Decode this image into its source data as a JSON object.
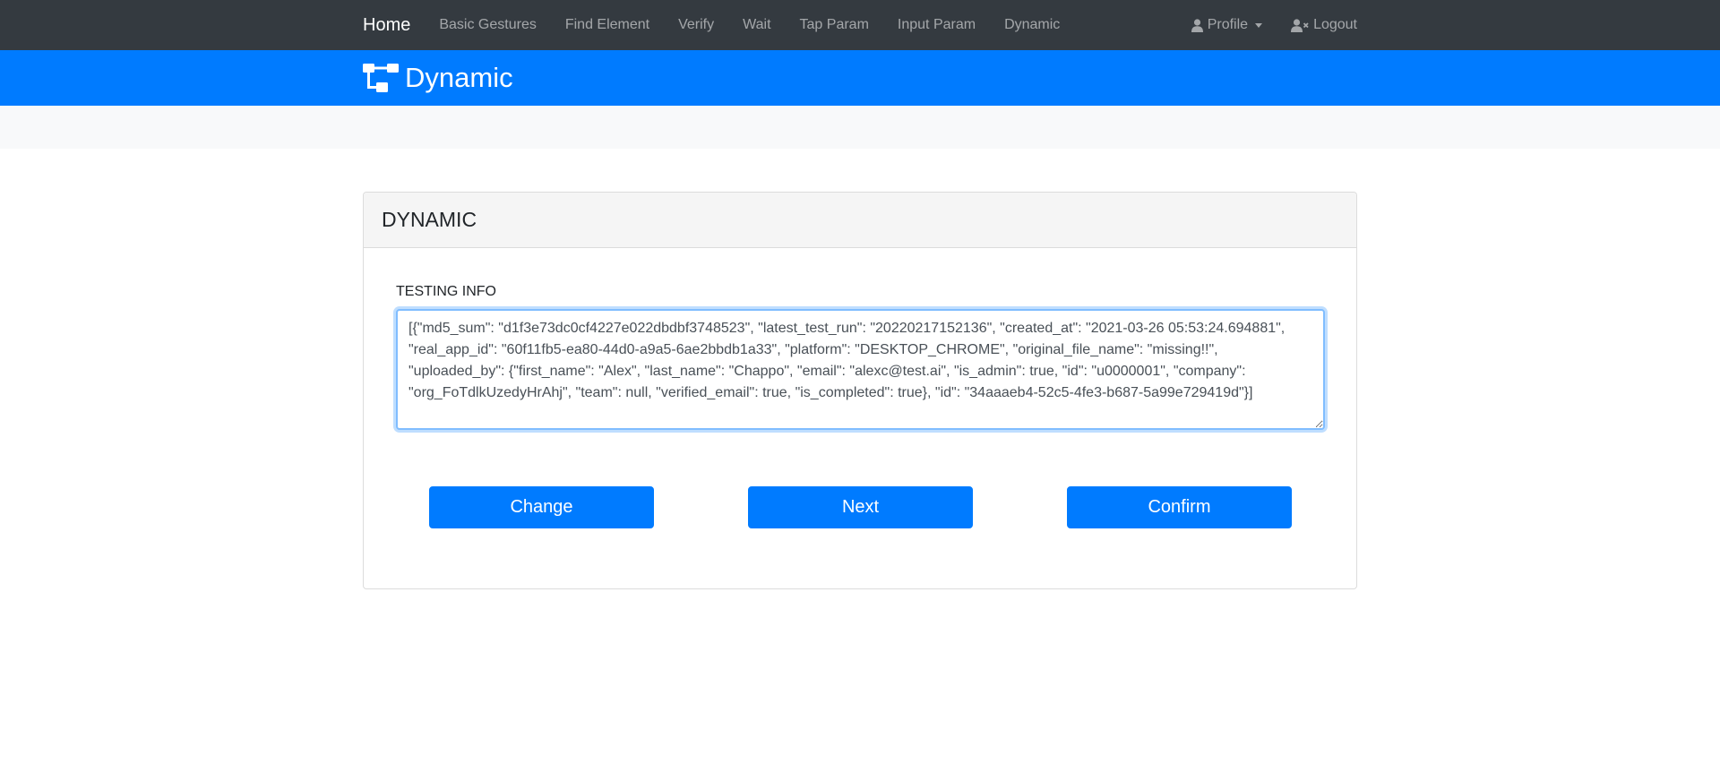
{
  "navbar": {
    "brand": "Home",
    "links": [
      "Basic Gestures",
      "Find Element",
      "Verify",
      "Wait",
      "Tap Param",
      "Input Param",
      "Dynamic"
    ],
    "profile_label": "Profile",
    "logout_label": "Logout"
  },
  "header": {
    "title": "Dynamic",
    "icon": "sitemap-icon"
  },
  "card": {
    "title": "DYNAMIC",
    "field_label": "TESTING INFO",
    "textarea_value": "[{\"md5_sum\": \"d1f3e73dc0cf4227e022dbdbf3748523\", \"latest_test_run\": \"20220217152136\", \"created_at\": \"2021-03-26 05:53:24.694881\", \"real_app_id\": \"60f11fb5-ea80-44d0-a9a5-6ae2bbdb1a33\", \"platform\": \"DESKTOP_CHROME\", \"original_file_name\": \"missing!!\", \"uploaded_by\": {\"first_name\": \"Alex\", \"last_name\": \"Chappo\", \"email\": \"alexc@test.ai\", \"is_admin\": true, \"id\": \"u0000001\", \"company\": \"org_FoTdlkUzedyHrAhj\", \"team\": null, \"verified_email\": true, \"is_completed\": true}, \"id\": \"34aaaeb4-52c5-4fe3-b687-5a99e729419d\"}]",
    "buttons": {
      "change": "Change",
      "next": "Next",
      "confirm": "Confirm"
    }
  },
  "colors": {
    "navbar_bg": "#343a40",
    "primary": "#007bff",
    "strip_bg": "#f8f9fa",
    "card_header_bg": "#f5f5f5"
  }
}
